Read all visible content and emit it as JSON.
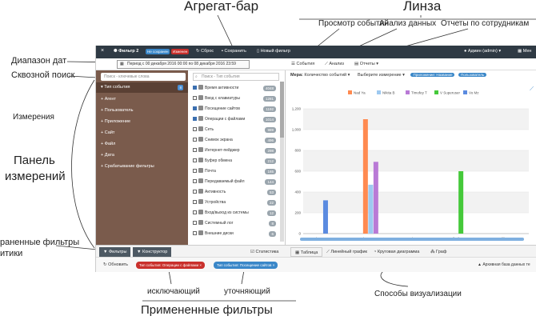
{
  "callouts": {
    "aggbar": "Агрегат-бар",
    "lens": "Линза",
    "events_view": "Просмотр событий",
    "data_analysis": "Анализ данных",
    "employee_reports": "Отчеты по сотрудникам",
    "date_range": "Диапазон дат",
    "search": "Сквозной поиск",
    "dimensions": "Измерения",
    "panel_line1": "Панель",
    "panel_line2": "измерений",
    "saved_filters_line1": "раненные фильтры",
    "saved_filters_line2": "итики",
    "exclusive": "исключающий",
    "refining": "уточняющий",
    "applied_filters": "Примененные фильтры",
    "vis_methods": "Способы визуализации"
  },
  "topbar": {
    "filter_title": "Фильтр 2",
    "not_saved": "Не сохранен",
    "changed": "Изменен",
    "reset": "Сброс",
    "save": "Сохранить",
    "new_filter": "Новый фильтр",
    "user": "Админ (admin)",
    "menu": "Мен"
  },
  "datebar": {
    "period": "Период с 00 декабря 2016 00:00 по 08 декабря 2016 23:59"
  },
  "lensbar": {
    "events": "События",
    "analysis": "Анализ",
    "reports": "Отчеты"
  },
  "dimpanel": {
    "search_placeholder": "Поиск - ключевые слова",
    "items": [
      {
        "label": "Тип события",
        "count": "8"
      },
      {
        "label": "Агент"
      },
      {
        "label": "Пользователь"
      },
      {
        "label": "Приложение"
      },
      {
        "label": "Сайт"
      },
      {
        "label": "Файл"
      },
      {
        "label": "Дата"
      },
      {
        "label": "Срабатывание фильтры"
      }
    ]
  },
  "aggpanel": {
    "search_placeholder": "Поиск - Тип события",
    "items": [
      {
        "label": "Время активности",
        "count": "4048",
        "checked": true
      },
      {
        "label": "Ввод с клавиатуры",
        "count": "1281",
        "checked": false
      },
      {
        "label": "Посещение сайтов",
        "count": "1192",
        "checked": true
      },
      {
        "label": "Операции с файлами",
        "count": "1014",
        "checked": true
      },
      {
        "label": "Сеть",
        "count": "989",
        "checked": false
      },
      {
        "label": "Снимок экрана",
        "count": "496",
        "checked": false
      },
      {
        "label": "Интернет-пейджер",
        "count": "298",
        "checked": false
      },
      {
        "label": "Буфер обмена",
        "count": "212",
        "checked": false
      },
      {
        "label": "Почта",
        "count": "165",
        "checked": false
      },
      {
        "label": "Передаваемый файл",
        "count": "144",
        "checked": false
      },
      {
        "label": "Активность",
        "count": "53",
        "checked": false
      },
      {
        "label": "Устройства",
        "count": "22",
        "checked": false
      },
      {
        "label": "Вход/выход из системы",
        "count": "12",
        "checked": false
      },
      {
        "label": "Системный лог",
        "count": "8",
        "checked": false
      },
      {
        "label": "Внешние диски",
        "count": "6",
        "checked": false
      }
    ]
  },
  "chartarea": {
    "measure_label": "Мера:",
    "measure_value": "Количество событий",
    "dimension_select": "Выберите измерение",
    "chip_app": "Приложение: Название",
    "chip_user": "Пользователь"
  },
  "bottomtabs": {
    "filters": "Фильтры",
    "constructor": "Конструктор",
    "statistics": "Статистика",
    "table": "Таблица",
    "line": "Линейный график",
    "pie": "Круговая диаграмма",
    "graph": "Граф"
  },
  "filterbar": {
    "refresh": "Обновить",
    "chip_exclude": "Тип события: Операции с файлами",
    "chip_include": "Тип события: Посещение сайтов",
    "archive": "Архивная база данных те"
  },
  "colors": {
    "topbar": "#2f3a44",
    "dim_panel": "#7a5b4c",
    "chip_red": "#c9302c",
    "chip_blue": "#3a87c8"
  },
  "chart_data": {
    "type": "bar",
    "categories": [
      "browser.exe",
      "chrome.exe",
      "explorer.exe",
      "firefox.exe",
      "r-life.exe"
    ],
    "series": [
      {
        "name": "Nad Ya",
        "color": "#ff8a50",
        "values": [
          0,
          1100,
          0,
          0,
          0
        ]
      },
      {
        "name": "Nikita B",
        "color": "#9ec9f0",
        "values": [
          0,
          470,
          0,
          0,
          0
        ]
      },
      {
        "name": "Timofey T",
        "color": "#b97ad6",
        "values": [
          0,
          690,
          0,
          0,
          0
        ]
      },
      {
        "name": "V Superuser",
        "color": "#45c93a",
        "values": [
          0,
          0,
          0,
          600,
          0
        ]
      },
      {
        "name": "Vo Mz",
        "color": "#5b8be0",
        "values": [
          320,
          0,
          0,
          0,
          0
        ]
      }
    ],
    "yticks": [
      0,
      200,
      400,
      600,
      800,
      1000,
      1200
    ],
    "ylim": [
      0,
      1200
    ],
    "legend": "top"
  }
}
